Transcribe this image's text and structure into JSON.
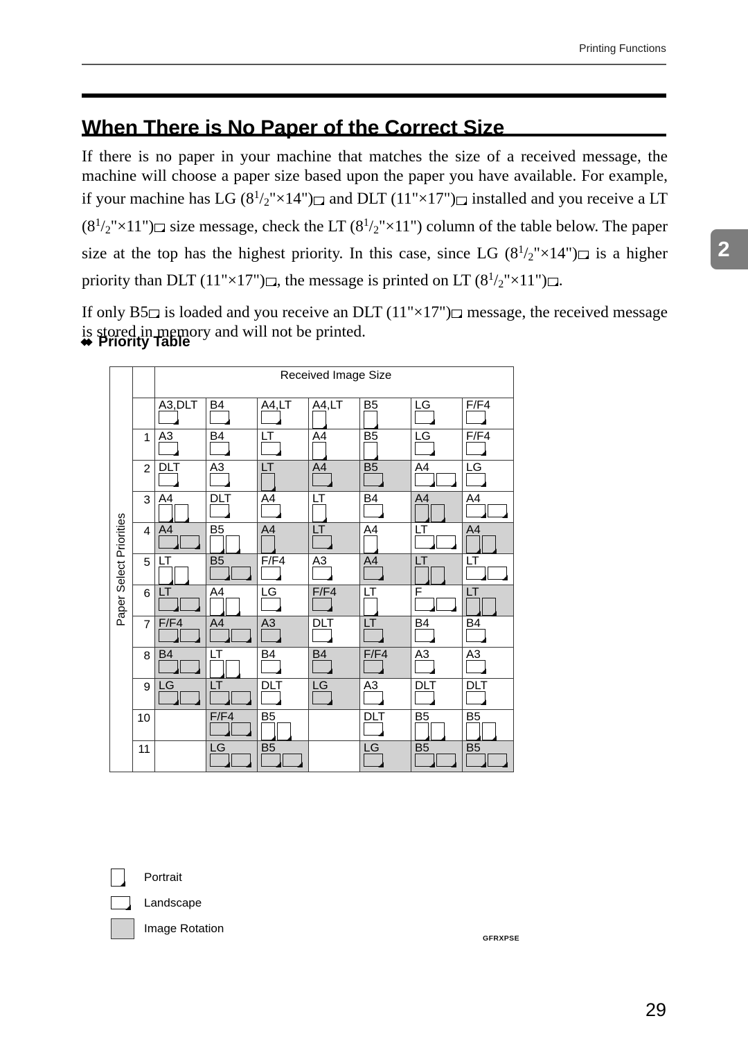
{
  "running_header": "Printing Functions",
  "chapter_tab": "2",
  "page_number": "29",
  "title": "When There is No Paper of the Correct Size",
  "body": {
    "para1_a": "If there is no paper in your machine that matches the size of a received message, the machine will choose a paper size based upon the paper you have available. For example, if your machine has LG (8",
    "para1_frac_num": "1",
    "para1_frac_den": "2",
    "para1_b": "\"×14\")",
    "para1_c": " and DLT (11\"×17\")",
    "para1_d": " installed and you receive a LT (8",
    "para1_e": "\"×11\")",
    "para1_f": " size message, check the LT (8",
    "para1_g": "\"×11\") column of the table below. The paper size at the top has the highest priority. In this case, since LG (8",
    "para1_h": "\"×14\")",
    "para1_i": " is a higher priority than DLT (11\"×17\")",
    "para1_j": ", the message is printed on LT (8",
    "para1_k": "\"×11\")",
    "para1_l": ".",
    "para2_a": "If only B5",
    "para2_b": " is loaded and you receive an DLT (11\"×17\")",
    "para2_c": " message, the received message is stored in memory and will not be printed."
  },
  "section_heading": "Priority Table",
  "table": {
    "band_header": "Received Image Size",
    "row_axis_label": "Paper Select Priorities",
    "columns": [
      {
        "label": "A3,DLT",
        "orient": "land"
      },
      {
        "label": "B4",
        "orient": "land"
      },
      {
        "label": "A4,LT",
        "orient": "land"
      },
      {
        "label": "A4,LT",
        "orient": "port"
      },
      {
        "label": "B5",
        "orient": "port"
      },
      {
        "label": "LG",
        "orient": "land"
      },
      {
        "label": "F/F4",
        "orient": "land"
      }
    ],
    "rows": [
      {
        "rank": "1",
        "cells": [
          {
            "label": "A3",
            "icons": [
              "land"
            ],
            "shade": false
          },
          {
            "label": "B4",
            "icons": [
              "land"
            ],
            "shade": false
          },
          {
            "label": "LT",
            "icons": [
              "land"
            ],
            "shade": false
          },
          {
            "label": "A4",
            "icons": [
              "port"
            ],
            "shade": false
          },
          {
            "label": "B5",
            "icons": [
              "port"
            ],
            "shade": false
          },
          {
            "label": "LG",
            "icons": [
              "land"
            ],
            "shade": false
          },
          {
            "label": "F/F4",
            "icons": [
              "land"
            ],
            "shade": false
          }
        ]
      },
      {
        "rank": "2",
        "cells": [
          {
            "label": "DLT",
            "icons": [
              "land"
            ],
            "shade": false
          },
          {
            "label": "A3",
            "icons": [
              "land"
            ],
            "shade": false
          },
          {
            "label": "LT",
            "icons": [
              "port"
            ],
            "shade": true
          },
          {
            "label": "A4",
            "icons": [
              "land"
            ],
            "shade": true
          },
          {
            "label": "B5",
            "icons": [
              "land"
            ],
            "shade": true
          },
          {
            "label": "A4",
            "icons": [
              "land",
              "land"
            ],
            "shade": false
          },
          {
            "label": "LG",
            "icons": [
              "land"
            ],
            "shade": false
          }
        ]
      },
      {
        "rank": "3",
        "cells": [
          {
            "label": "A4",
            "icons": [
              "port",
              "port"
            ],
            "shade": false
          },
          {
            "label": "DLT",
            "icons": [
              "land"
            ],
            "shade": false
          },
          {
            "label": "A4",
            "icons": [
              "land"
            ],
            "shade": false
          },
          {
            "label": "LT",
            "icons": [
              "port"
            ],
            "shade": false
          },
          {
            "label": "B4",
            "icons": [
              "land"
            ],
            "shade": false
          },
          {
            "label": "A4",
            "icons": [
              "port",
              "port"
            ],
            "shade": true
          },
          {
            "label": "A4",
            "icons": [
              "land",
              "land"
            ],
            "shade": false
          }
        ]
      },
      {
        "rank": "4",
        "cells": [
          {
            "label": "A4",
            "icons": [
              "land",
              "land"
            ],
            "shade": true
          },
          {
            "label": "B5",
            "icons": [
              "port",
              "port"
            ],
            "shade": false
          },
          {
            "label": "A4",
            "icons": [
              "port"
            ],
            "shade": true
          },
          {
            "label": "LT",
            "icons": [
              "land"
            ],
            "shade": true
          },
          {
            "label": "A4",
            "icons": [
              "port"
            ],
            "shade": false
          },
          {
            "label": "LT",
            "icons": [
              "land",
              "land"
            ],
            "shade": false
          },
          {
            "label": "A4",
            "icons": [
              "port",
              "port"
            ],
            "shade": true
          }
        ]
      },
      {
        "rank": "5",
        "cells": [
          {
            "label": "LT",
            "icons": [
              "port",
              "port"
            ],
            "shade": false
          },
          {
            "label": "B5",
            "icons": [
              "land",
              "land"
            ],
            "shade": true
          },
          {
            "label": "F/F4",
            "icons": [
              "land"
            ],
            "shade": false
          },
          {
            "label": "A3",
            "icons": [
              "land"
            ],
            "shade": false
          },
          {
            "label": "A4",
            "icons": [
              "land"
            ],
            "shade": true
          },
          {
            "label": "LT",
            "icons": [
              "port",
              "port"
            ],
            "shade": true
          },
          {
            "label": "LT",
            "icons": [
              "land",
              "land"
            ],
            "shade": false
          }
        ]
      },
      {
        "rank": "6",
        "cells": [
          {
            "label": "LT",
            "icons": [
              "land",
              "land"
            ],
            "shade": true
          },
          {
            "label": "A4",
            "icons": [
              "port",
              "port"
            ],
            "shade": false
          },
          {
            "label": "LG",
            "icons": [
              "land"
            ],
            "shade": false
          },
          {
            "label": "F/F4",
            "icons": [
              "land"
            ],
            "shade": true
          },
          {
            "label": "LT",
            "icons": [
              "port"
            ],
            "shade": false
          },
          {
            "label": "F",
            "icons": [
              "land",
              "land"
            ],
            "shade": false
          },
          {
            "label": "LT",
            "icons": [
              "port",
              "port"
            ],
            "shade": true
          }
        ]
      },
      {
        "rank": "7",
        "cells": [
          {
            "label": "F/F4",
            "icons": [
              "land",
              "land"
            ],
            "shade": true
          },
          {
            "label": "A4",
            "icons": [
              "land",
              "land"
            ],
            "shade": true
          },
          {
            "label": "A3",
            "icons": [
              "land"
            ],
            "shade": true
          },
          {
            "label": "DLT",
            "icons": [
              "land"
            ],
            "shade": false
          },
          {
            "label": "LT",
            "icons": [
              "land"
            ],
            "shade": true
          },
          {
            "label": "B4",
            "icons": [
              "land"
            ],
            "shade": false
          },
          {
            "label": "B4",
            "icons": [
              "land"
            ],
            "shade": false
          }
        ]
      },
      {
        "rank": "8",
        "cells": [
          {
            "label": "B4",
            "icons": [
              "land",
              "land"
            ],
            "shade": true
          },
          {
            "label": "LT",
            "icons": [
              "port",
              "port"
            ],
            "shade": false
          },
          {
            "label": "B4",
            "icons": [
              "land"
            ],
            "shade": false
          },
          {
            "label": "B4",
            "icons": [
              "land"
            ],
            "shade": true
          },
          {
            "label": "F/F4",
            "icons": [
              "land"
            ],
            "shade": true
          },
          {
            "label": "A3",
            "icons": [
              "land"
            ],
            "shade": false
          },
          {
            "label": "A3",
            "icons": [
              "land"
            ],
            "shade": false
          }
        ]
      },
      {
        "rank": "9",
        "cells": [
          {
            "label": "LG",
            "icons": [
              "land",
              "land"
            ],
            "shade": true
          },
          {
            "label": "LT",
            "icons": [
              "land",
              "land"
            ],
            "shade": true
          },
          {
            "label": "DLT",
            "icons": [
              "land"
            ],
            "shade": false
          },
          {
            "label": "LG",
            "icons": [
              "land"
            ],
            "shade": true
          },
          {
            "label": "A3",
            "icons": [
              "land"
            ],
            "shade": false
          },
          {
            "label": "DLT",
            "icons": [
              "land"
            ],
            "shade": false
          },
          {
            "label": "DLT",
            "icons": [
              "land"
            ],
            "shade": false
          }
        ]
      },
      {
        "rank": "10",
        "cells": [
          {
            "label": "",
            "icons": [],
            "shade": false
          },
          {
            "label": "F/F4",
            "icons": [
              "land",
              "land"
            ],
            "shade": true
          },
          {
            "label": "B5",
            "icons": [
              "port",
              "port"
            ],
            "shade": false
          },
          {
            "label": "",
            "icons": [],
            "shade": false
          },
          {
            "label": "DLT",
            "icons": [
              "land"
            ],
            "shade": false
          },
          {
            "label": "B5",
            "icons": [
              "port",
              "port"
            ],
            "shade": false
          },
          {
            "label": "B5",
            "icons": [
              "port",
              "port"
            ],
            "shade": false
          }
        ]
      },
      {
        "rank": "11",
        "cells": [
          {
            "label": "",
            "icons": [],
            "shade": false
          },
          {
            "label": "LG",
            "icons": [
              "land",
              "land"
            ],
            "shade": true
          },
          {
            "label": "B5",
            "icons": [
              "land",
              "land"
            ],
            "shade": true
          },
          {
            "label": "",
            "icons": [],
            "shade": false
          },
          {
            "label": "LG",
            "icons": [
              "land"
            ],
            "shade": true
          },
          {
            "label": "B5",
            "icons": [
              "land",
              "land"
            ],
            "shade": true
          },
          {
            "label": "B5",
            "icons": [
              "land",
              "land"
            ],
            "shade": true
          }
        ]
      }
    ]
  },
  "legend": [
    {
      "icon": "portrait-page-icon",
      "label": "Portrait"
    },
    {
      "icon": "landscape-page-icon",
      "label": "Landscape"
    },
    {
      "icon": "gray-square-icon",
      "label": "Image Rotation"
    }
  ],
  "artwork_code": "GFRXPSE",
  "colors": {
    "shade": "#d2d2d2",
    "tab": "#7d7d7d",
    "rule": "#000000"
  }
}
